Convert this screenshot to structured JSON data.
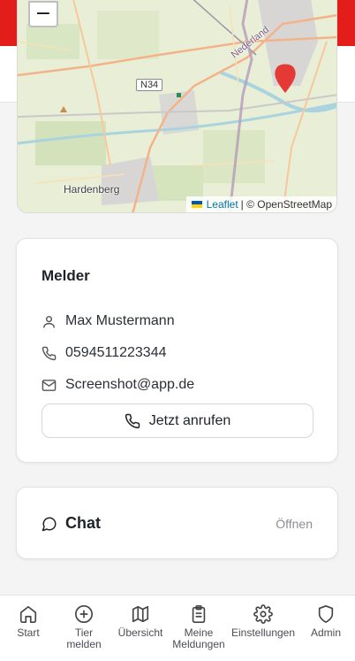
{
  "map": {
    "zoom_out_label": "−",
    "attribution_link": "Leaflet",
    "attribution_rest": "| © OpenStreetMap",
    "labels": {
      "town": "Hardenberg",
      "road": "N34",
      "border": "Nederland"
    }
  },
  "melder": {
    "title": "Melder",
    "name": "Max Mustermann",
    "phone": "0594511223344",
    "email": "Screenshot@app.de",
    "call_label": "Jetzt anrufen"
  },
  "chat": {
    "title": "Chat",
    "action": "Öffnen"
  },
  "nav": [
    {
      "label": "Start",
      "icon": "home-icon"
    },
    {
      "label": "Tier\nmelden",
      "icon": "plus-circle-icon"
    },
    {
      "label": "Übersicht",
      "icon": "map-icon"
    },
    {
      "label": "Meine\nMeldungen",
      "icon": "clipboard-icon"
    },
    {
      "label": "Einstellungen",
      "icon": "gear-icon"
    },
    {
      "label": "Admin",
      "icon": "shield-icon"
    }
  ],
  "colors": {
    "brand": "#e31d1a",
    "marker": "#e53935",
    "link": "#0078a8"
  }
}
